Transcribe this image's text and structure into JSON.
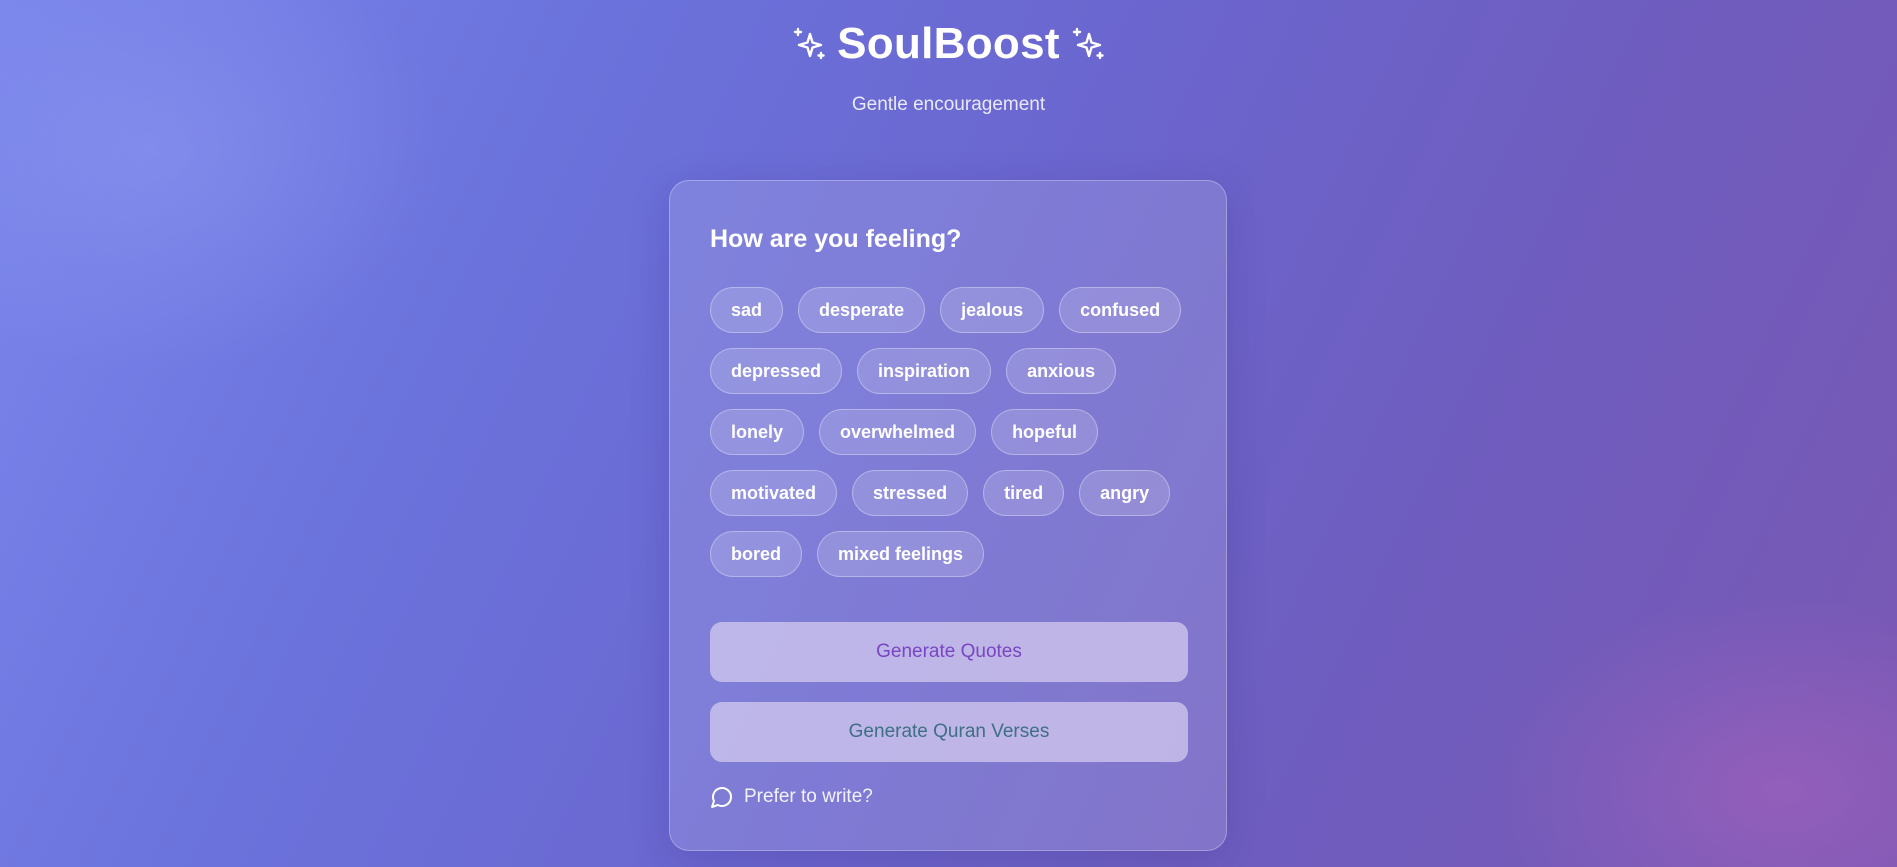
{
  "header": {
    "title": "SoulBoost",
    "subtitle": "Gentle encouragement",
    "left_icon": "sparkles-icon",
    "right_icon": "sparkles-icon"
  },
  "card": {
    "heading": "How are you feeling?",
    "mood_rows": [
      [
        "sad",
        "desperate",
        "jealous",
        "confused"
      ],
      [
        "depressed",
        "inspiration",
        "anxious"
      ],
      [
        "lonely",
        "overwhelmed",
        "hopeful"
      ],
      [
        "motivated",
        "stressed",
        "tired",
        "angry"
      ],
      [
        "bored",
        "mixed feelings"
      ]
    ],
    "generate_quotes_label": "Generate Quotes",
    "generate_quran_label": "Generate Quran Verses",
    "write_link_label": "Prefer to write?",
    "write_link_icon": "message-circle-icon"
  },
  "colors": {
    "background_start": "#7b86ec",
    "background_end": "#7a58b4",
    "quotes_button_text": "#7a45c2",
    "quran_button_text": "#3f6f85"
  }
}
